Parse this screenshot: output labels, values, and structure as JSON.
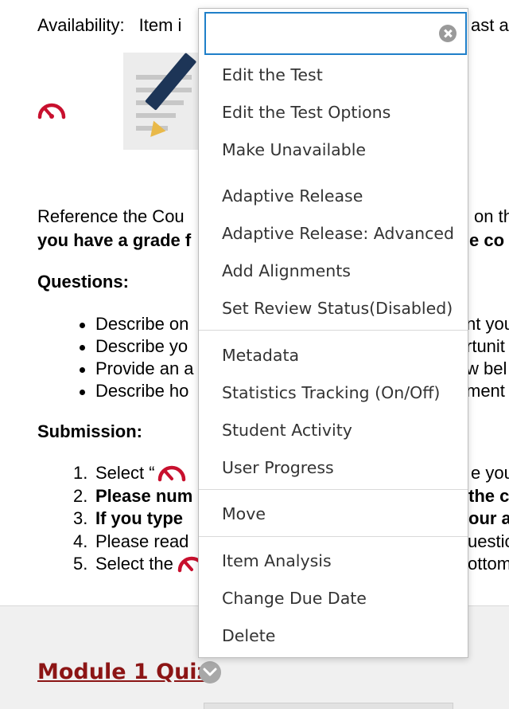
{
  "availability": {
    "label": "Availability:",
    "text_left": "Item i",
    "text_right": "ast av"
  },
  "description": {
    "line1_left": "Reference the Cou",
    "line1_right": "on th",
    "line2_left": "you have a grade f",
    "line2_right": "e co"
  },
  "questions": {
    "heading": "Questions:",
    "items": [
      {
        "left": "Describe on",
        "right": "nt you"
      },
      {
        "left": "Describe yo",
        "right": "rtunit"
      },
      {
        "left": "Provide an a",
        "right": "w bel"
      },
      {
        "left": "Describe ho",
        "right": "ment"
      }
    ]
  },
  "submission": {
    "heading": "Submission:",
    "items": [
      {
        "num": "1.",
        "left": "Select “",
        "right": "e you"
      },
      {
        "num": "2.",
        "left": "Please num",
        "right": "the c"
      },
      {
        "num": "3.",
        "left": "If you type",
        "right": "our a"
      },
      {
        "num": "4.",
        "left": "Please read",
        "right": "uestic"
      },
      {
        "num": "5.",
        "left": "Select the",
        "right": "ottom"
      }
    ]
  },
  "module": {
    "title": "Module 1 Quiz"
  },
  "menu": {
    "search_value": "",
    "items": [
      "Edit the Test",
      "Edit the Test Options",
      "Make Unavailable",
      "Adaptive Release",
      "Adaptive Release: Advanced",
      "Add Alignments",
      "Set Review Status(Disabled)",
      "Metadata",
      "Statistics Tracking (On/Off)",
      "Student Activity",
      "User Progress",
      "Move",
      "Item Analysis",
      "Change Due Date",
      "Delete"
    ]
  },
  "colors": {
    "brand_red": "#8c1515",
    "icon_red": "#c8102e",
    "focus_blue": "#1f7fc9"
  },
  "icons": {
    "speed": "speedometer-icon",
    "clear": "clear-circle-icon",
    "chevron": "chevron-down-icon"
  }
}
